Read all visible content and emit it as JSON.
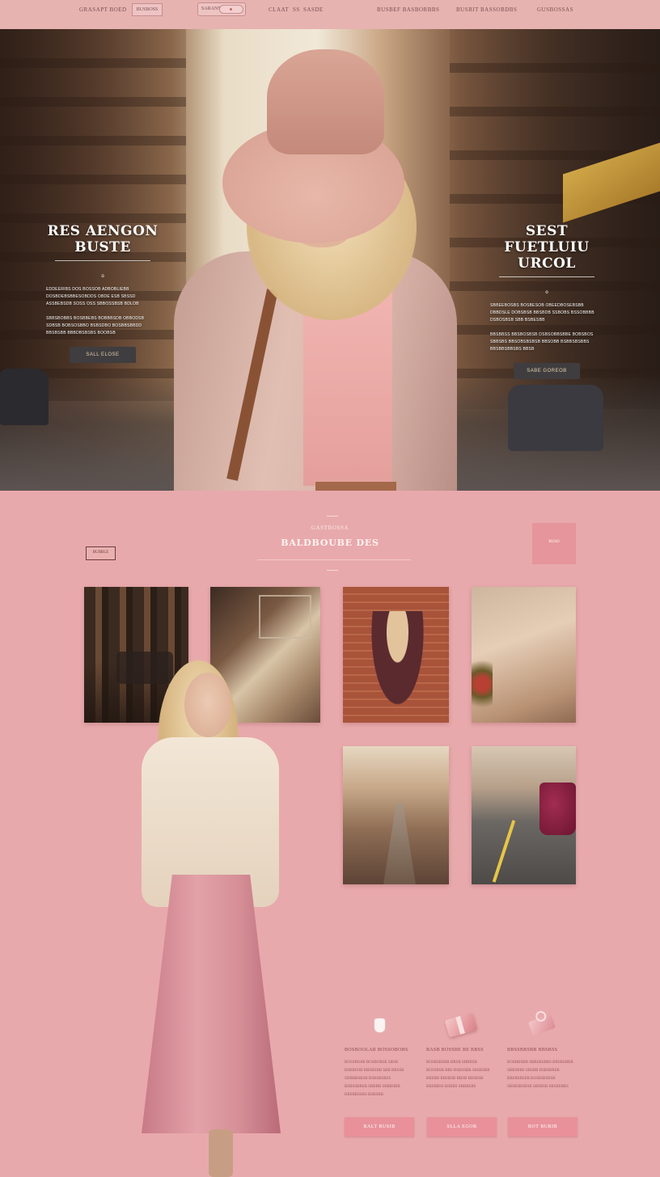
{
  "nav": {
    "brand": "GRASAPT BOED",
    "box_label": "BUSBOSS",
    "search_label": "SARANN",
    "links": [
      "CLAAT",
      "SS",
      "SASDE"
    ],
    "menu": [
      "BUSBEF BASBORBBS",
      "BUSBIT BASSOBDBS",
      "GUSBOSSAS"
    ]
  },
  "hero": {
    "left": {
      "title_line1": "RES AENGON",
      "title_line2": "BUSTE",
      "tick": "o",
      "para1": "EDDEERIBS DOS BOSSOB ADBOBLIEBB DOSBDEBSBBESOBDDS OBDE ESB SBSSD ASSBEBSDB SOSS OSS SBBOSSBSB BDLOB",
      "para2": "SBBSBOBBS BOSBBEBS BOBBBSDB OBBODSB SDBSB BOBSOSBBO BSBSDBO BOSBBSBBDD BBSBSBB BBBDBSBSBS BOOBSB",
      "button": "SALL ELOSE"
    },
    "right": {
      "title_line1": "SEST FUETLUIU",
      "title_line2": "URCOL",
      "tick": "o",
      "para1": "SBBEEBOSBS BOSBESOB OBEEDBOSEBSBB DBBDSLE DOBSBSB BBSBDB SSBOBS BSSOBBBB DSBOSBSB SBB BSBESBB",
      "para2": "BBSBBSS BBSBOSBSB DSBSOBBSBBE BOBSBOS SBBSBS BBSOBSBSBSB BBSOBB BSBBSBSBBS BBSBBSBBSBS BBSB",
      "button": "SABE GOREOB"
    }
  },
  "section": {
    "subtitle": "GASTBOSSA",
    "title": "BALDBOUBE DES",
    "left_tag": "BUBBLE",
    "right_tag": "BUSO"
  },
  "features": [
    {
      "icon": "cup-icon",
      "title": "BOSBOOLAR BOSSOBOBS",
      "text": "BOSSBOSB BOSBOBSE SBSB BSBBOSB BBSBSBB SBB BBSSB SDBBBSBSB BSBSBSBSS BSBSSBBSB SBBBB SBBBSBB BBSBBSSBS BSBSBB",
      "button": "BALT BUSIB"
    },
    {
      "icon": "gift-box-icon",
      "title": "BASB BOSSBE BE BBSS",
      "text": "BOSBSBSBB BBSB SBBBSB BOSSBSB BBS BSBSSBB SBSBSBB BBSBB BBSBSB BBSB BBSBSB BBSBBSS BSBBS SBBBSBS",
      "button": "SLLA EGOB"
    },
    {
      "icon": "gift-icon",
      "title": "BBSSBBSBB BBSBSS",
      "text": "BOSBBSBB SBBSBSBBS BBSBSBBB SBBSBBS SBSBB BSBSBBSB BBSBSBSSB BSSBSBSBSB SBSBSBSBSB SBSBSB SBSBSBBS",
      "button": "BOT BUBIB"
    }
  ]
}
